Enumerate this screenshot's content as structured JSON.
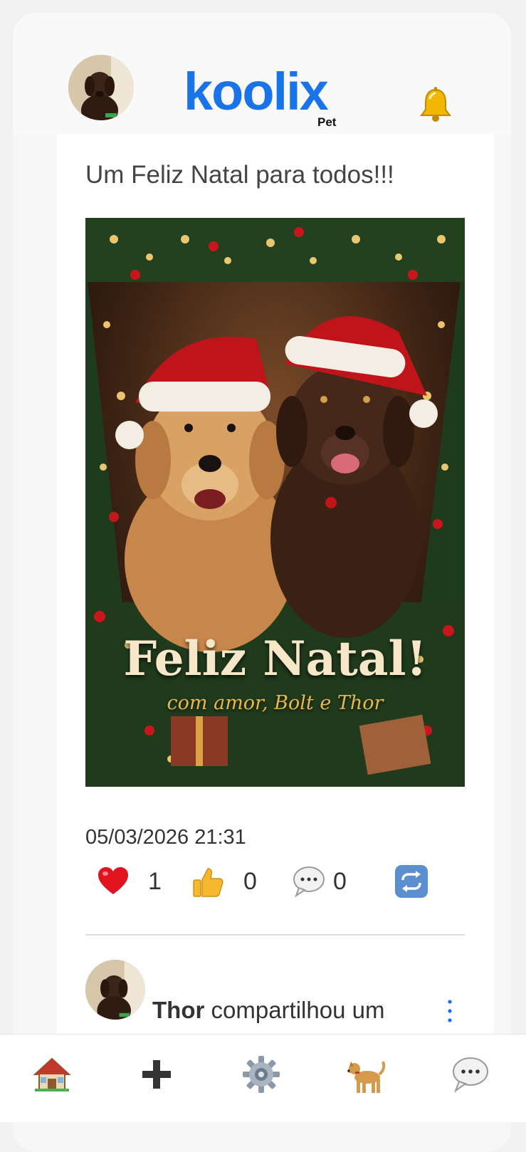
{
  "header": {
    "logo_main": "koolix",
    "logo_sub": "Pet",
    "avatar_icon": "dog-avatar",
    "bell_icon": "bell-icon"
  },
  "post": {
    "text": "Um Feliz Natal para todos!!!",
    "image": {
      "title": "Feliz Natal!",
      "subtitle": "com amor, Bolt e Thor"
    },
    "timestamp": "05/03/2026 21:31",
    "reactions": {
      "heart_count": "1",
      "like_count": "0",
      "comment_count": "0"
    }
  },
  "next_post": {
    "author": "Thor",
    "action": " compartilhou um"
  },
  "nav": {
    "items": [
      "home-icon",
      "add-icon",
      "settings-icon",
      "dog-icon",
      "chat-icon"
    ]
  },
  "colors": {
    "brand": "#1a73e8",
    "heart": "#e0141e",
    "thumb": "#f5b82e"
  }
}
